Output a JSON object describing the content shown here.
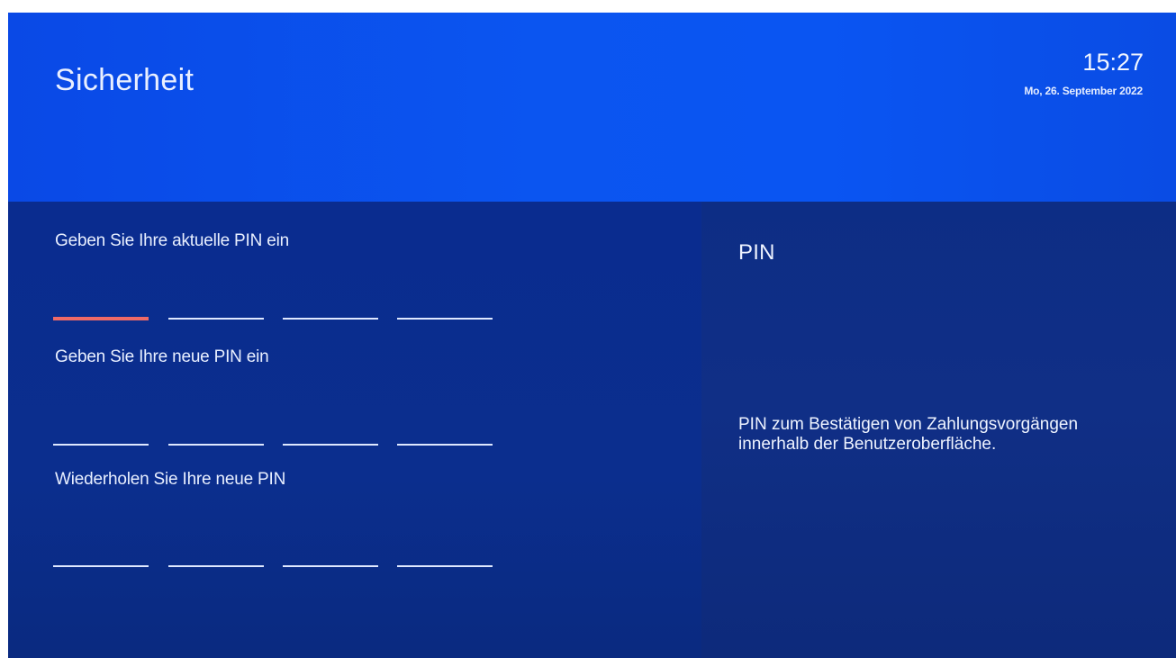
{
  "header": {
    "title": "Sicherheit",
    "time": "15:27",
    "date": "Mo, 26. September 2022"
  },
  "form": {
    "fields": [
      {
        "label": "Geben Sie Ihre aktuelle PIN ein",
        "digits_entered": 0,
        "active": true
      },
      {
        "label": "Geben Sie Ihre neue PIN ein",
        "digits_entered": 0,
        "active": false
      },
      {
        "label": "Wiederholen Sie Ihre neue PIN",
        "digits_entered": 0,
        "active": false
      }
    ]
  },
  "help": {
    "title": "PIN",
    "text": "PIN zum Bestätigen von Zahlungsvorgängen innerhalb der Benutzeroberfläche."
  },
  "colors": {
    "header_blue": "#0b55f0",
    "panel_blue": "#0b2e8e",
    "active_underline": "#ef6a67",
    "inactive_underline": "#dfe8ff"
  }
}
